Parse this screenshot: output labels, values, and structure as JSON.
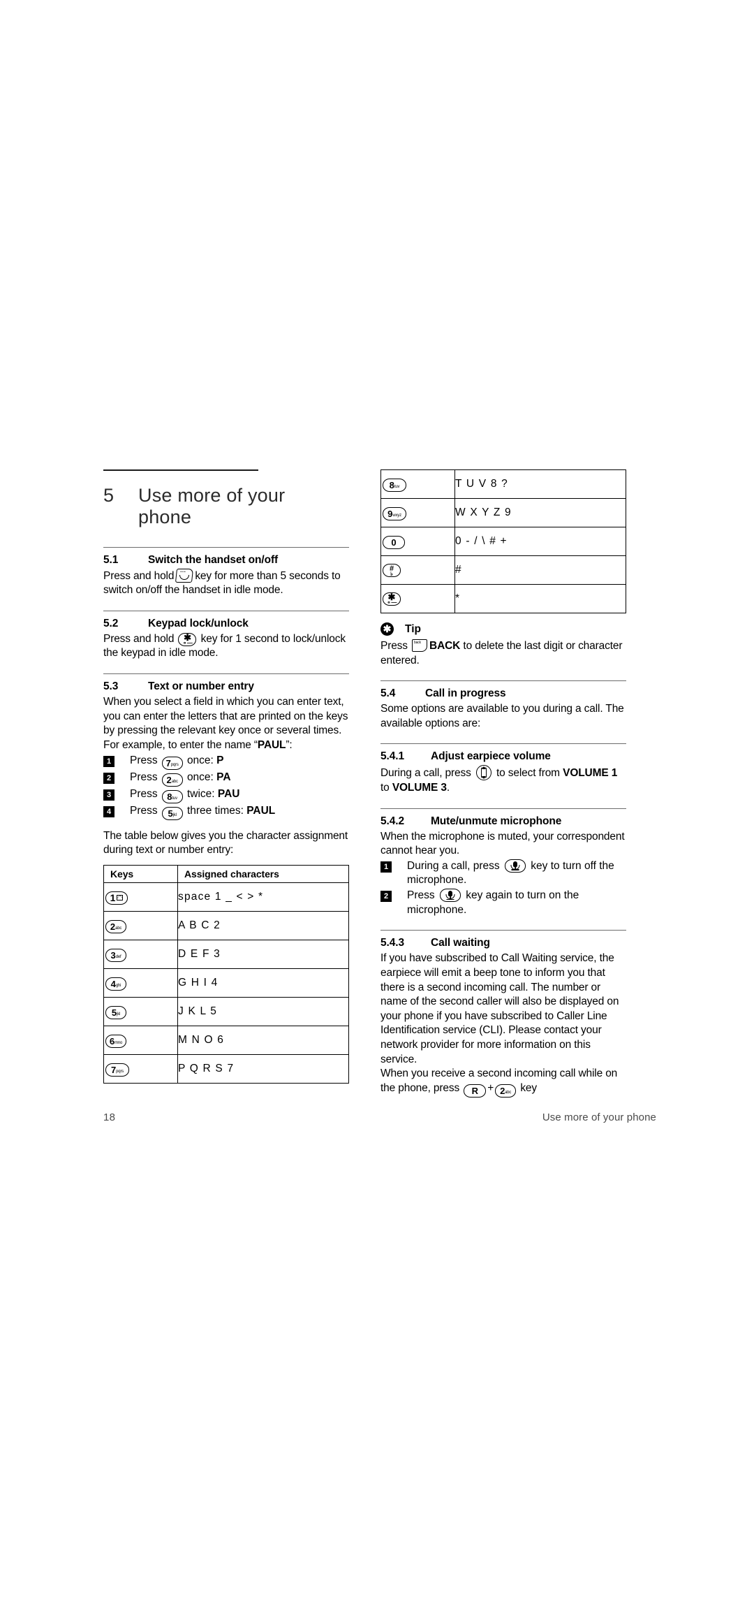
{
  "chapter": {
    "number": "5",
    "title_line1": "Use more of your",
    "title_line2": "phone"
  },
  "sections": {
    "s51": {
      "num": "5.1",
      "title": "Switch the handset on/off",
      "text_before_key": "Press and hold",
      "text_after_key": "key for more than 5 seconds to switch on/off the handset in idle mode."
    },
    "s52": {
      "num": "5.2",
      "title": "Keypad lock/unlock",
      "text_before_key": "Press and hold",
      "text_after_key": "key for 1 second to lock/unlock the keypad in idle mode."
    },
    "s53": {
      "num": "5.3",
      "title": "Text or number entry",
      "intro_part1": "When you select a field in which you can enter text, you can enter the letters that are printed on the keys by pressing the relevant key once or several times. For example, to enter the name “",
      "intro_bold": "PAUL",
      "intro_part2": "”:",
      "steps": [
        {
          "n": "1",
          "verb": "Press",
          "key_digit": "7",
          "key_sub": "pqrs",
          "mid": "once:",
          "result": "P"
        },
        {
          "n": "2",
          "verb": "Press",
          "key_digit": "2",
          "key_sub": "abc",
          "mid": "once:",
          "result": "PA"
        },
        {
          "n": "3",
          "verb": "Press",
          "key_digit": "8",
          "key_sub": "tuv",
          "mid": "twice:",
          "result": "PAU"
        },
        {
          "n": "4",
          "verb": "Press",
          "key_digit": "5",
          "key_sub": "jkl",
          "mid": "three times:",
          "result": "PAUL"
        }
      ],
      "table_intro": "The table below gives you the character assignment during text or number entry:"
    },
    "tip": {
      "icon": "asterisk-icon",
      "label": "Tip",
      "text_before_key": "Press",
      "key_label": "BACK",
      "text_after_key": "to delete the last digit or character entered."
    },
    "s54": {
      "num": "5.4",
      "title": "Call in progress",
      "text": "Some options are available to you during a call. The available options are:"
    },
    "s541": {
      "num": "5.4.1",
      "title": "Adjust earpiece volume",
      "text_before_key": "During a call, press",
      "text_after_key_1": "to select from",
      "bold_1": "VOLUME 1",
      "mid": "to",
      "bold_2": "VOLUME 3",
      "tail": "."
    },
    "s542": {
      "num": "5.4.2",
      "title": "Mute/unmute microphone",
      "text": "When the microphone is muted, your correspondent cannot hear you.",
      "steps": [
        {
          "n": "1",
          "before": "During a call, press",
          "after": "key to turn off the microphone."
        },
        {
          "n": "2",
          "before": "Press",
          "after": "key again to turn on the microphone."
        }
      ]
    },
    "s543": {
      "num": "5.4.3",
      "title": "Call waiting",
      "para1": "If you have subscribed to Call Waiting service, the earpiece will emit a beep tone to inform you that there is a second incoming call. The number or name of the second caller will also be displayed on your phone if you have subscribed to Caller Line Identification service (CLI). Please contact your network provider for more information on this service.",
      "para2_before": "When you receive a second incoming call while on the phone, press",
      "para2_plus": "+",
      "para2_after": "key"
    }
  },
  "char_table": {
    "headers": {
      "keys": "Keys",
      "chars": "Assigned characters"
    },
    "left_rows": [
      {
        "key_digit": "1",
        "key_sub": "envelope-icon",
        "chars": "space 1 _  <  >  *"
      },
      {
        "key_digit": "2",
        "key_sub": "abc",
        "chars": "A B C 2"
      },
      {
        "key_digit": "3",
        "key_sub": "def",
        "chars": "D E F 3"
      },
      {
        "key_digit": "4",
        "key_sub": "ghi",
        "chars": "G H I 4"
      },
      {
        "key_digit": "5",
        "key_sub": "jkl",
        "chars": "J K L 5"
      },
      {
        "key_digit": "6",
        "key_sub": "mno",
        "chars": "M N O 6"
      },
      {
        "key_digit": "7",
        "key_sub": "pqrs",
        "chars": "P Q R S 7"
      }
    ],
    "right_rows": [
      {
        "key_digit": "8",
        "key_sub": "tuv",
        "chars": "T U V 8 ?"
      },
      {
        "key_digit": "9",
        "key_sub": "wxyz",
        "chars": "W X Y Z 9"
      },
      {
        "key_digit": "0",
        "key_sub": "",
        "chars": "0 - / \\ # +"
      },
      {
        "key_digit": "#",
        "key_sub": "",
        "chars": "#"
      },
      {
        "key_digit": "*",
        "key_sub": "",
        "chars": "*"
      }
    ]
  },
  "footer": {
    "page_number": "18",
    "title": "Use more of your phone"
  }
}
